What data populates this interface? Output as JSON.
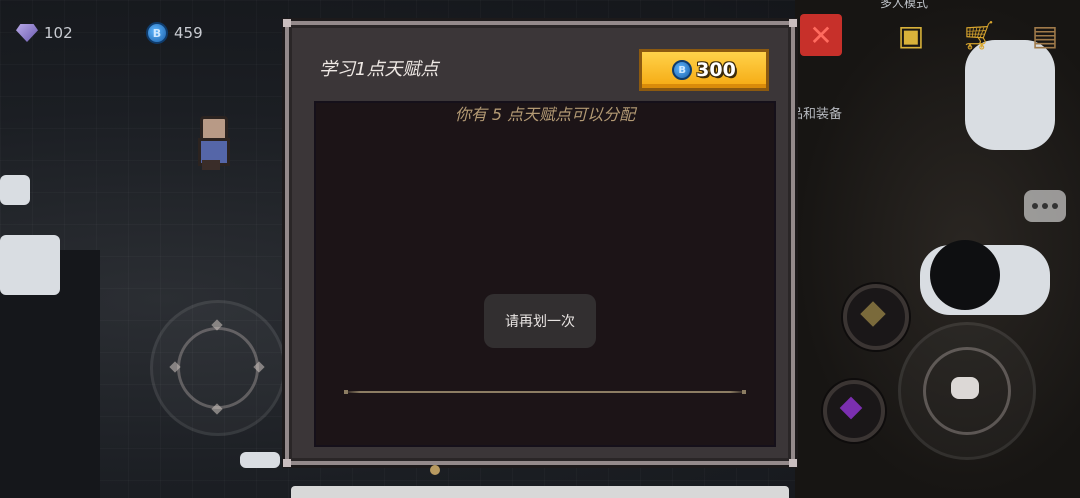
{
  "hud": {
    "gems": "102",
    "coins": "459"
  },
  "top_right": {
    "mode_label": "多人模式",
    "equip_label": "品和装备"
  },
  "dialog": {
    "title": "学习1点天赋点",
    "price": "300",
    "coin_glyph": "B",
    "hint": "你有 5 点天赋点可以分配"
  },
  "toast": {
    "message": "请再划一次"
  },
  "colors": {
    "price_button": "#f5a911",
    "close_button": "#c7302a",
    "hint_text": "#b39a74",
    "dialog_border": "#948a8b",
    "panel_bg": "#1c1417"
  },
  "icons": {
    "gem": "gem-icon",
    "coin": "coin-icon",
    "close": "close-icon",
    "chat": "chat-icon",
    "shop": "shop-cart-icon",
    "backpack": "backpack-icon"
  }
}
